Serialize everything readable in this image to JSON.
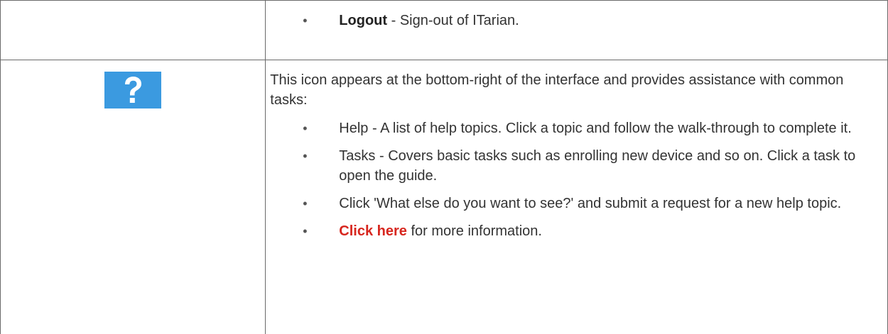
{
  "logout_row": {
    "term": "Logout",
    "text": " - Sign-out of ITarian."
  },
  "help_row": {
    "icon": "question-mark-icon",
    "icon_color": "#3b9ae0",
    "intro": "This icon appears at the bottom-right of the interface and provides assistance with common tasks:",
    "items": [
      "Help - A list of help topics. Click a topic and follow the walk-through to complete it.",
      "Tasks - Covers basic tasks such as enrolling new device and so on. Click a task to open the guide.",
      "Click 'What else do you want to see?' and submit a request for a new help topic."
    ],
    "more_link": "Click here",
    "more_text": " for more information.",
    "link_color": "#d7261e"
  },
  "bullet_glyph": "•"
}
